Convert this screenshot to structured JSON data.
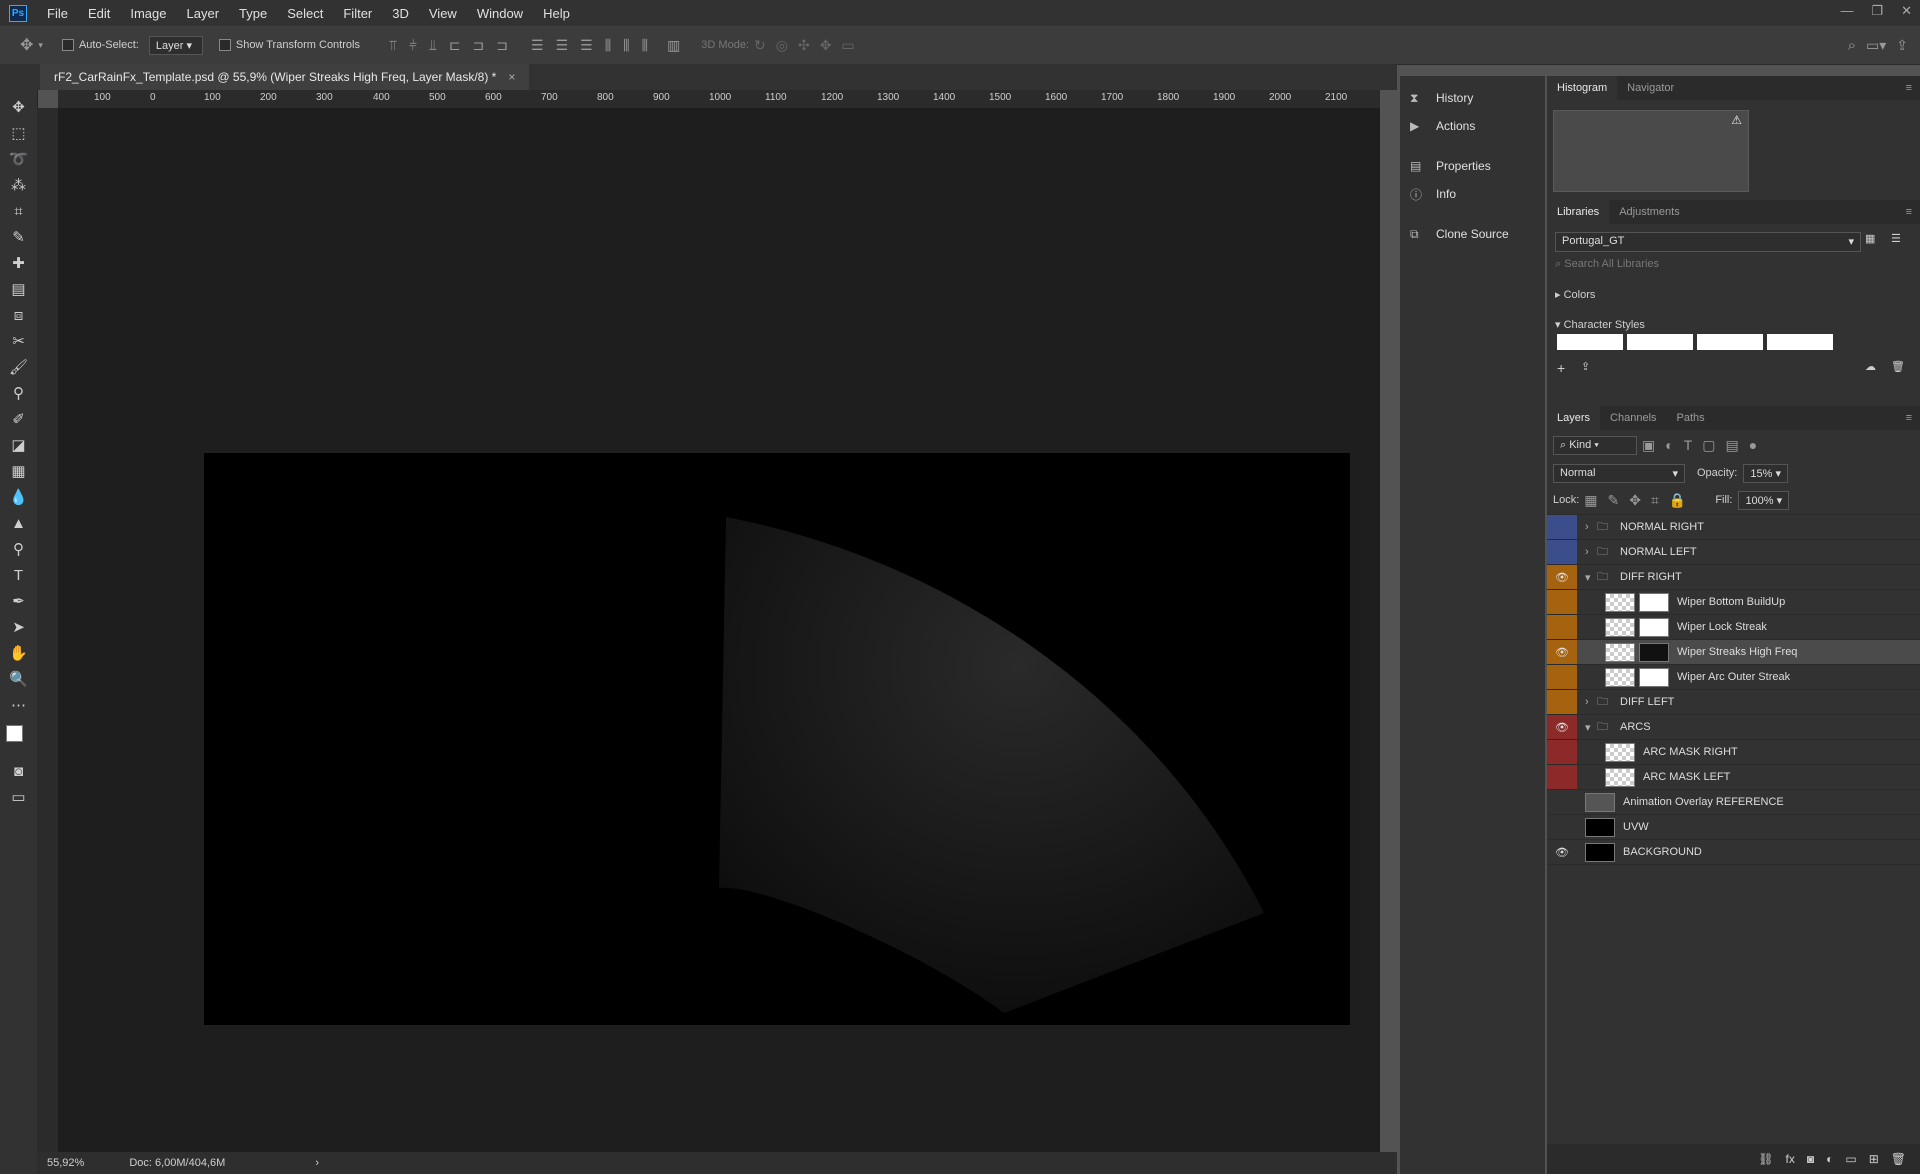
{
  "app": {
    "logo": "Ps"
  },
  "menu": [
    "File",
    "Edit",
    "Image",
    "Layer",
    "Type",
    "Select",
    "Filter",
    "3D",
    "View",
    "Window",
    "Help"
  ],
  "options": {
    "auto_select_label": "Auto-Select:",
    "auto_select_value": "Layer",
    "show_transform_label": "Show Transform Controls",
    "mode_3d_label": "3D Mode:"
  },
  "document": {
    "tab_title": "rF2_CarRainFx_Template.psd @ 55,9% (Wiper Streaks High Freq, Layer Mask/8) *",
    "close": "×"
  },
  "ruler_top": [
    "100",
    "0",
    "100",
    "200",
    "300",
    "400",
    "500",
    "600",
    "700",
    "800",
    "900",
    "1000",
    "1100",
    "1200",
    "1300",
    "1400",
    "1500",
    "1600",
    "1700",
    "1800",
    "1900",
    "2000",
    "2100"
  ],
  "status": {
    "zoom": "55,92%",
    "doc": "Doc: 6,00M/404,6M"
  },
  "mid_panels": [
    {
      "label": "History",
      "icon": "history-icon"
    },
    {
      "label": "Actions",
      "icon": "actions-icon"
    },
    {
      "label": "Properties",
      "icon": "properties-icon"
    },
    {
      "label": "Info",
      "icon": "info-icon"
    },
    {
      "label": "Clone Source",
      "icon": "clone-source-icon"
    }
  ],
  "histogram_tabs": [
    "Histogram",
    "Navigator"
  ],
  "libraries": {
    "tabs": [
      "Libraries",
      "Adjustments"
    ],
    "selected": "Portugal_GT",
    "search_placeholder": "Search All Libraries",
    "colors_label": "Colors",
    "char_styles_label": "Character Styles"
  },
  "layers_panel": {
    "tabs": [
      "Layers",
      "Channels",
      "Paths"
    ],
    "kind": "Kind",
    "blend": "Normal",
    "opacity_label": "Opacity:",
    "opacity": "15%",
    "lock_label": "Lock:",
    "fill_label": "Fill:",
    "fill": "100%",
    "layers": [
      {
        "name": "NORMAL RIGHT",
        "type": "group",
        "color": "#3b4d8a",
        "visible": false,
        "expanded": false,
        "indent": 0
      },
      {
        "name": "NORMAL LEFT",
        "type": "group",
        "color": "#3b4d8a",
        "visible": false,
        "expanded": false,
        "indent": 0
      },
      {
        "name": "DIFF RIGHT",
        "type": "group",
        "color": "#a5620f",
        "visible": true,
        "expanded": true,
        "indent": 0
      },
      {
        "name": "Wiper Bottom BuildUp",
        "type": "layer",
        "color": "#a5620f",
        "visible": false,
        "indent": 1
      },
      {
        "name": "Wiper Lock Streak",
        "type": "layer",
        "color": "#a5620f",
        "visible": false,
        "indent": 1
      },
      {
        "name": "Wiper Streaks High Freq",
        "type": "layer",
        "color": "#a5620f",
        "visible": true,
        "indent": 1,
        "selected": true
      },
      {
        "name": "Wiper Arc Outer Streak",
        "type": "layer",
        "color": "#a5620f",
        "visible": false,
        "indent": 1
      },
      {
        "name": "DIFF LEFT",
        "type": "group",
        "color": "#a5620f",
        "visible": false,
        "expanded": false,
        "indent": 0
      },
      {
        "name": "ARCS",
        "type": "group",
        "color": "#8c2a2a",
        "visible": true,
        "expanded": true,
        "indent": 0
      },
      {
        "name": "ARC MASK RIGHT",
        "type": "layer",
        "color": "#8c2a2a",
        "visible": false,
        "indent": 1
      },
      {
        "name": "ARC MASK LEFT",
        "type": "layer",
        "color": "#8c2a2a",
        "visible": false,
        "indent": 1
      },
      {
        "name": "Animation Overlay REFERENCE",
        "type": "layer",
        "color": "",
        "visible": false,
        "indent": 0
      },
      {
        "name": "UVW",
        "type": "layer",
        "color": "",
        "visible": false,
        "indent": 0
      },
      {
        "name": "BACKGROUND",
        "type": "layer",
        "color": "",
        "visible": true,
        "indent": 0
      }
    ]
  }
}
